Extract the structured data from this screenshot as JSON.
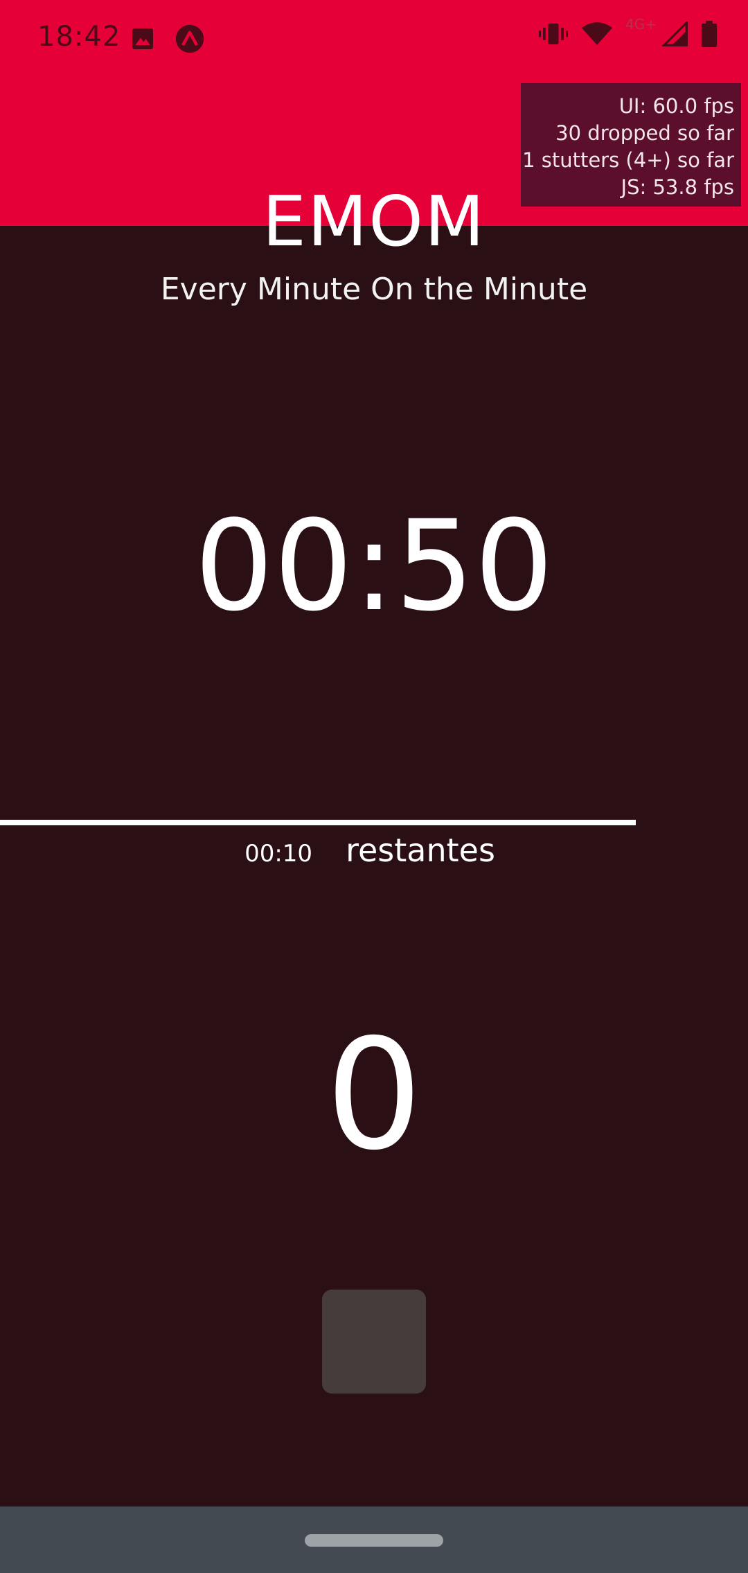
{
  "status_bar": {
    "time": "18:42",
    "network_label": "4G+",
    "icons": [
      "image-icon",
      "app-notification-icon",
      "vibrate-icon",
      "wifi-icon",
      "cell-signal-icon",
      "battery-icon"
    ]
  },
  "perf_overlay": {
    "ui_fps": "UI: 60.0 fps",
    "dropped": "30 dropped so far",
    "stutters": "1 stutters (4+) so far",
    "js_fps": "JS: 53.8 fps"
  },
  "header": {
    "title": "EMOM",
    "subtitle": "Every Minute On the Minute"
  },
  "timer": {
    "elapsed": "00:50",
    "progress_fraction": 0.85,
    "remaining_time": "00:10",
    "remaining_label": "restantes"
  },
  "rounds": {
    "count": "0"
  },
  "controls": {
    "stop_icon": "stop-icon"
  },
  "colors": {
    "header_red": "#e60038",
    "background": "#2a0f15",
    "overlay": "#5c0f2c",
    "button": "#463c3c",
    "nav_bar": "#434a52"
  }
}
